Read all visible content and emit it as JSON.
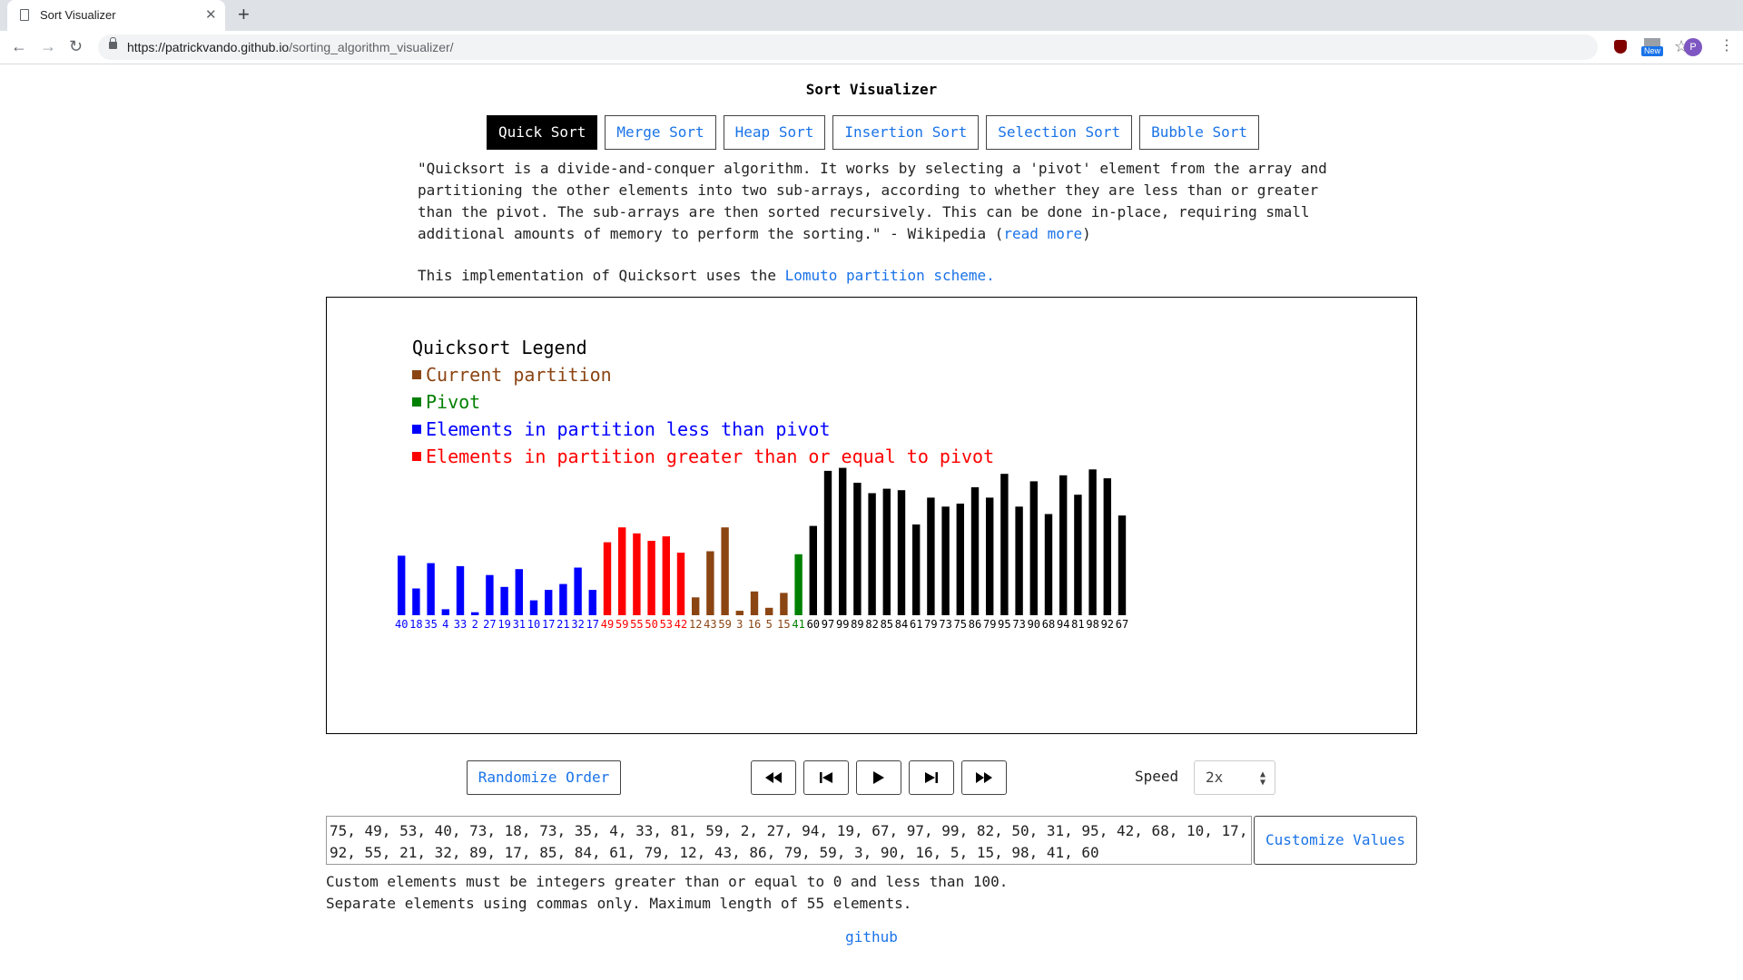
{
  "browser": {
    "tab_title": "Sort Visualizer",
    "url_host": "https://patrickvando.github.io",
    "url_path": "/sorting_algorithm_visualizer/",
    "new_badge": "New",
    "avatar_letter": "P"
  },
  "page": {
    "title": "Sort Visualizer",
    "tabs": [
      "Quick Sort",
      "Merge Sort",
      "Heap Sort",
      "Insertion Sort",
      "Selection Sort",
      "Bubble Sort"
    ],
    "active_tab": "Quick Sort",
    "description": "\"Quicksort is a divide-and-conquer algorithm. It works by selecting a 'pivot' element from the array and partitioning the other elements into two sub-arrays, according to whether they are less than or greater than the pivot. The sub-arrays are then sorted recursively. This can be done in-place, requiring small additional amounts of memory to perform the sorting.\" - Wikipedia (",
    "read_more": "read more",
    "description_end": ")",
    "impl_text": "This implementation of Quicksort uses the ",
    "impl_link": "Lomuto partition scheme."
  },
  "legend": {
    "title": "Quicksort Legend",
    "items": [
      {
        "label": "Current partition",
        "color": "#8b4513"
      },
      {
        "label": "Pivot",
        "color": "#008000"
      },
      {
        "label": "Elements in partition less than pivot",
        "color": "#0000ff"
      },
      {
        "label": "Elements in partition greater than or equal to pivot",
        "color": "#ff0000"
      }
    ]
  },
  "chart_data": {
    "type": "bar",
    "ylim": [
      0,
      100
    ],
    "values": [
      40,
      18,
      35,
      4,
      33,
      2,
      27,
      19,
      31,
      10,
      17,
      21,
      32,
      17,
      49,
      59,
      55,
      50,
      53,
      42,
      12,
      43,
      59,
      3,
      16,
      5,
      15,
      41,
      60,
      97,
      99,
      89,
      82,
      85,
      84,
      61,
      79,
      73,
      75,
      86,
      79,
      95,
      73,
      90,
      68,
      94,
      81,
      98,
      92,
      67
    ],
    "states": [
      "less",
      "less",
      "less",
      "less",
      "less",
      "less",
      "less",
      "less",
      "less",
      "less",
      "less",
      "less",
      "less",
      "less",
      "greater",
      "greater",
      "greater",
      "greater",
      "greater",
      "greater",
      "partition",
      "partition",
      "partition",
      "partition",
      "partition",
      "partition",
      "partition",
      "pivot",
      "default",
      "default",
      "default",
      "default",
      "default",
      "default",
      "default",
      "default",
      "default",
      "default",
      "default",
      "default",
      "default",
      "default",
      "default",
      "default",
      "default",
      "default",
      "default",
      "default",
      "default",
      "default"
    ],
    "state_colors": {
      "less": "#0000ff",
      "greater": "#ff0000",
      "partition": "#8b4513",
      "pivot": "#008000",
      "default": "#000000"
    }
  },
  "controls": {
    "randomize": "Randomize Order",
    "speed_label": "Speed",
    "speed_value": "2x"
  },
  "custom": {
    "values_text": "75, 49, 53, 40, 73, 18, 73, 35, 4, 33, 81, 59, 2, 27, 94, 19, 67, 97, 99, 82, 50, 31, 95, 42, 68, 10, 17, 92, 55, 21, 32, 89, 17, 85, 84, 61, 79, 12, 43, 86, 79, 59, 3, 90, 16, 5, 15, 98, 41, 60",
    "customize_button": "Customize Values",
    "help_line1": "Custom elements must be integers greater than or equal to 0 and less than 100.",
    "help_line2": "Separate elements using commas only. Maximum length of 55 elements.",
    "github": "github"
  }
}
